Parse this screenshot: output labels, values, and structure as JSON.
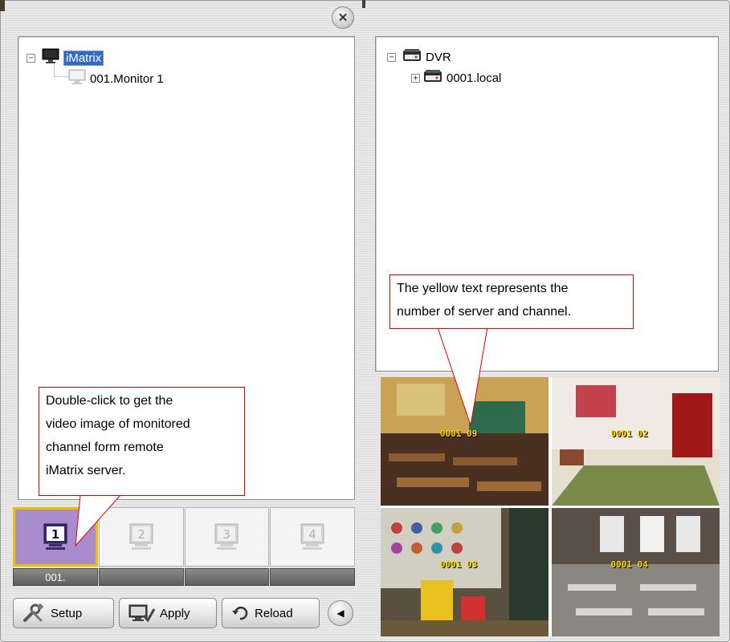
{
  "left_tree": {
    "root_label": "iMatrix",
    "child_label": "001.Monitor 1"
  },
  "right_tree": {
    "root_label": "DVR",
    "child_label": "0001.local"
  },
  "thumbnails": [
    {
      "number": "1",
      "label": "001."
    },
    {
      "number": "2",
      "label": ""
    },
    {
      "number": "3",
      "label": ""
    },
    {
      "number": "4",
      "label": ""
    }
  ],
  "toolbar": {
    "setup_label": "Setup",
    "apply_label": "Apply",
    "reload_label": "Reload"
  },
  "cameras": [
    {
      "label": "0001 09"
    },
    {
      "label": "0001 02"
    },
    {
      "label": "0001 03"
    },
    {
      "label": "0001 04"
    }
  ],
  "callouts": {
    "left_text_1": "Double-click to get the",
    "left_text_2": "video image of monitored",
    "left_text_3": "channel form remote",
    "left_text_4": "iMatrix server.",
    "right_text_1": "The yellow text represents the",
    "right_text_2": "number of server and channel."
  },
  "colors": {
    "selection": "#316ac5",
    "active_thumb_border": "#e8c400",
    "active_thumb_fill": "#a98ccc",
    "camera_label": "#ffd800",
    "callout_border": "#e00000"
  }
}
